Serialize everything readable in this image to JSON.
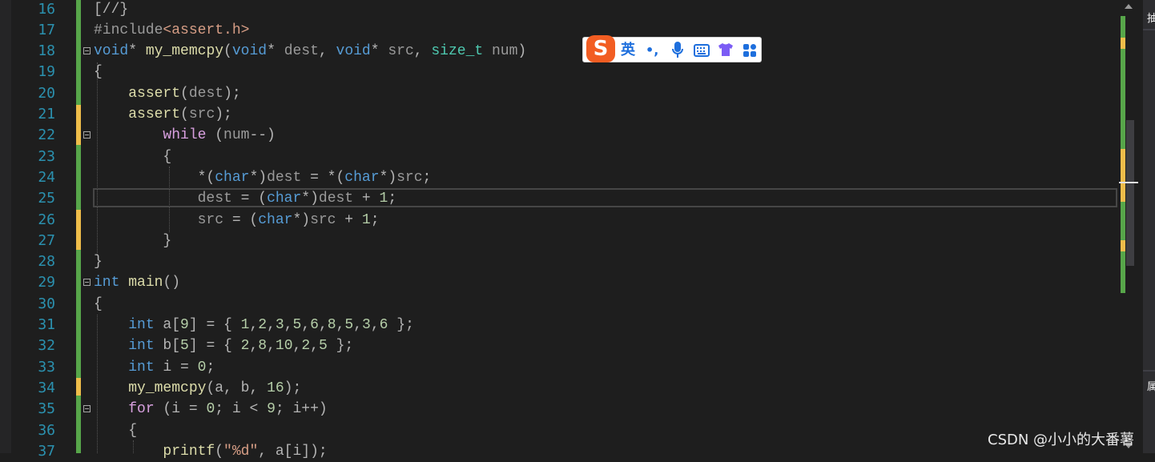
{
  "editor": {
    "lines": [
      {
        "num": "16",
        "tokens": [
          [
            "punc",
            "[//}"
          ]
        ]
      },
      {
        "num": "17",
        "tokens": [
          [
            "pre",
            "#include"
          ],
          [
            "str",
            "<assert.h>"
          ]
        ]
      },
      {
        "num": "18",
        "tokens": [
          [
            "kw",
            "void"
          ],
          [
            "punc",
            "* "
          ],
          [
            "fn",
            "my_memcpy"
          ],
          [
            "punc",
            "("
          ],
          [
            "kw",
            "void"
          ],
          [
            "punc",
            "* "
          ],
          [
            "param",
            "dest"
          ],
          [
            "punc",
            ", "
          ],
          [
            "kw",
            "void"
          ],
          [
            "punc",
            "* "
          ],
          [
            "param",
            "src"
          ],
          [
            "punc",
            ", "
          ],
          [
            "type",
            "size_t"
          ],
          [
            "punc",
            " "
          ],
          [
            "param",
            "num"
          ],
          [
            "punc",
            ")"
          ]
        ]
      },
      {
        "num": "19",
        "tokens": [
          [
            "punc",
            "{"
          ]
        ]
      },
      {
        "num": "20",
        "tokens": [
          [
            "punc",
            "    "
          ],
          [
            "fn",
            "assert"
          ],
          [
            "punc",
            "("
          ],
          [
            "param",
            "dest"
          ],
          [
            "punc",
            ");"
          ]
        ]
      },
      {
        "num": "21",
        "tokens": [
          [
            "punc",
            "    "
          ],
          [
            "fn",
            "assert"
          ],
          [
            "punc",
            "("
          ],
          [
            "param",
            "src"
          ],
          [
            "punc",
            ");"
          ]
        ]
      },
      {
        "num": "22",
        "tokens": [
          [
            "punc",
            "        "
          ],
          [
            "ctrl",
            "while"
          ],
          [
            "punc",
            " ("
          ],
          [
            "param",
            "num"
          ],
          [
            "punc",
            "--)"
          ]
        ]
      },
      {
        "num": "23",
        "tokens": [
          [
            "punc",
            "        {"
          ]
        ]
      },
      {
        "num": "24",
        "tokens": [
          [
            "punc",
            "            *("
          ],
          [
            "kw",
            "char"
          ],
          [
            "punc",
            "*)"
          ],
          [
            "param",
            "dest"
          ],
          [
            "punc",
            " = *("
          ],
          [
            "kw",
            "char"
          ],
          [
            "punc",
            "*)"
          ],
          [
            "param",
            "src"
          ],
          [
            "punc",
            ";"
          ]
        ]
      },
      {
        "num": "25",
        "tokens": [
          [
            "punc",
            "            "
          ],
          [
            "param",
            "dest"
          ],
          [
            "punc",
            " = ("
          ],
          [
            "kw",
            "char"
          ],
          [
            "punc",
            "*)"
          ],
          [
            "param",
            "dest"
          ],
          [
            "punc",
            " + "
          ],
          [
            "num",
            "1"
          ],
          [
            "punc",
            ";"
          ]
        ]
      },
      {
        "num": "26",
        "tokens": [
          [
            "punc",
            "            "
          ],
          [
            "param",
            "src"
          ],
          [
            "punc",
            " = ("
          ],
          [
            "kw",
            "char"
          ],
          [
            "punc",
            "*)"
          ],
          [
            "param",
            "src"
          ],
          [
            "punc",
            " + "
          ],
          [
            "num",
            "1"
          ],
          [
            "punc",
            ";"
          ]
        ]
      },
      {
        "num": "27",
        "tokens": [
          [
            "punc",
            "        }"
          ]
        ]
      },
      {
        "num": "28",
        "tokens": [
          [
            "punc",
            "}"
          ]
        ]
      },
      {
        "num": "29",
        "tokens": [
          [
            "kw",
            "int"
          ],
          [
            "punc",
            " "
          ],
          [
            "fn",
            "main"
          ],
          [
            "punc",
            "()"
          ]
        ]
      },
      {
        "num": "30",
        "tokens": [
          [
            "punc",
            "{"
          ]
        ]
      },
      {
        "num": "31",
        "tokens": [
          [
            "punc",
            "    "
          ],
          [
            "kw",
            "int"
          ],
          [
            "punc",
            " a["
          ],
          [
            "num",
            "9"
          ],
          [
            "punc",
            "] = { "
          ],
          [
            "num",
            "1"
          ],
          [
            "punc",
            ","
          ],
          [
            "num",
            "2"
          ],
          [
            "punc",
            ","
          ],
          [
            "num",
            "3"
          ],
          [
            "punc",
            ","
          ],
          [
            "num",
            "5"
          ],
          [
            "punc",
            ","
          ],
          [
            "num",
            "6"
          ],
          [
            "punc",
            ","
          ],
          [
            "num",
            "8"
          ],
          [
            "punc",
            ","
          ],
          [
            "num",
            "5"
          ],
          [
            "punc",
            ","
          ],
          [
            "num",
            "3"
          ],
          [
            "punc",
            ","
          ],
          [
            "num",
            "6"
          ],
          [
            "punc",
            " };"
          ]
        ]
      },
      {
        "num": "32",
        "tokens": [
          [
            "punc",
            "    "
          ],
          [
            "kw",
            "int"
          ],
          [
            "punc",
            " b["
          ],
          [
            "num",
            "5"
          ],
          [
            "punc",
            "] = { "
          ],
          [
            "num",
            "2"
          ],
          [
            "punc",
            ","
          ],
          [
            "num",
            "8"
          ],
          [
            "punc",
            ","
          ],
          [
            "num",
            "10"
          ],
          [
            "punc",
            ","
          ],
          [
            "num",
            "2"
          ],
          [
            "punc",
            ","
          ],
          [
            "num",
            "5"
          ],
          [
            "punc",
            " };"
          ]
        ]
      },
      {
        "num": "33",
        "tokens": [
          [
            "punc",
            "    "
          ],
          [
            "kw",
            "int"
          ],
          [
            "punc",
            " i = "
          ],
          [
            "num",
            "0"
          ],
          [
            "punc",
            ";"
          ]
        ]
      },
      {
        "num": "34",
        "tokens": [
          [
            "punc",
            "    "
          ],
          [
            "fn",
            "my_memcpy"
          ],
          [
            "punc",
            "(a, b, "
          ],
          [
            "num",
            "16"
          ],
          [
            "punc",
            ");"
          ]
        ]
      },
      {
        "num": "35",
        "tokens": [
          [
            "punc",
            "    "
          ],
          [
            "ctrl",
            "for"
          ],
          [
            "punc",
            " (i = "
          ],
          [
            "num",
            "0"
          ],
          [
            "punc",
            "; i < "
          ],
          [
            "num",
            "9"
          ],
          [
            "punc",
            "; i++)"
          ]
        ]
      },
      {
        "num": "36",
        "tokens": [
          [
            "punc",
            "    {"
          ]
        ]
      },
      {
        "num": "37",
        "tokens": [
          [
            "punc",
            "        "
          ],
          [
            "fn",
            "printf"
          ],
          [
            "punc",
            "("
          ],
          [
            "str",
            "\"%d\""
          ],
          [
            "punc",
            ", a[i]);"
          ]
        ]
      }
    ]
  },
  "ime_toolbar": {
    "logo": "S",
    "mode": "英",
    "punct": "•,",
    "icons": [
      "microphone-icon",
      "keyboard-icon",
      "skin-icon",
      "apps-icon"
    ]
  },
  "right_panel": {
    "chars": [
      "抽",
      "属"
    ]
  },
  "watermark": "CSDN @小小的大番薯",
  "colors": {
    "keyword": "#569cd6",
    "control": "#d8a0df",
    "function": "#dcdcaa",
    "type": "#4ec9b0",
    "change_bar": "#57a64a",
    "modified": "#efbd4a"
  }
}
